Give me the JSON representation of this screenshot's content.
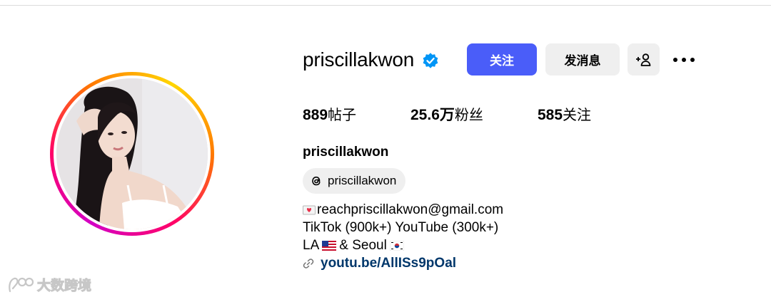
{
  "profile": {
    "username": "priscillakwon",
    "verified": true,
    "full_name": "priscillakwon",
    "threads_handle": "priscillakwon"
  },
  "actions": {
    "follow_label": "关注",
    "message_label": "发消息",
    "add_user_icon": "person-add-icon",
    "more_icon": "more-horizontal-icon"
  },
  "stats": {
    "posts": {
      "value": "889",
      "label": "帖子"
    },
    "followers": {
      "value": "25.6万",
      "label": "粉丝"
    },
    "following": {
      "value": "585",
      "label": "关注"
    }
  },
  "bio": {
    "email_line": "reachpriscillakwon@gmail.com",
    "platforms_line": "TikTok (900k+) YouTube (300k+)",
    "location_prefix": "LA",
    "location_mid": "& Seoul",
    "link_text": "youtu.be/AllISs9pOal"
  },
  "watermark": {
    "text": "大数跨境"
  },
  "colors": {
    "follow_button": "#4a5df9",
    "secondary_button": "#efefef",
    "link": "#00376b",
    "verified_badge": "#0095f6"
  }
}
